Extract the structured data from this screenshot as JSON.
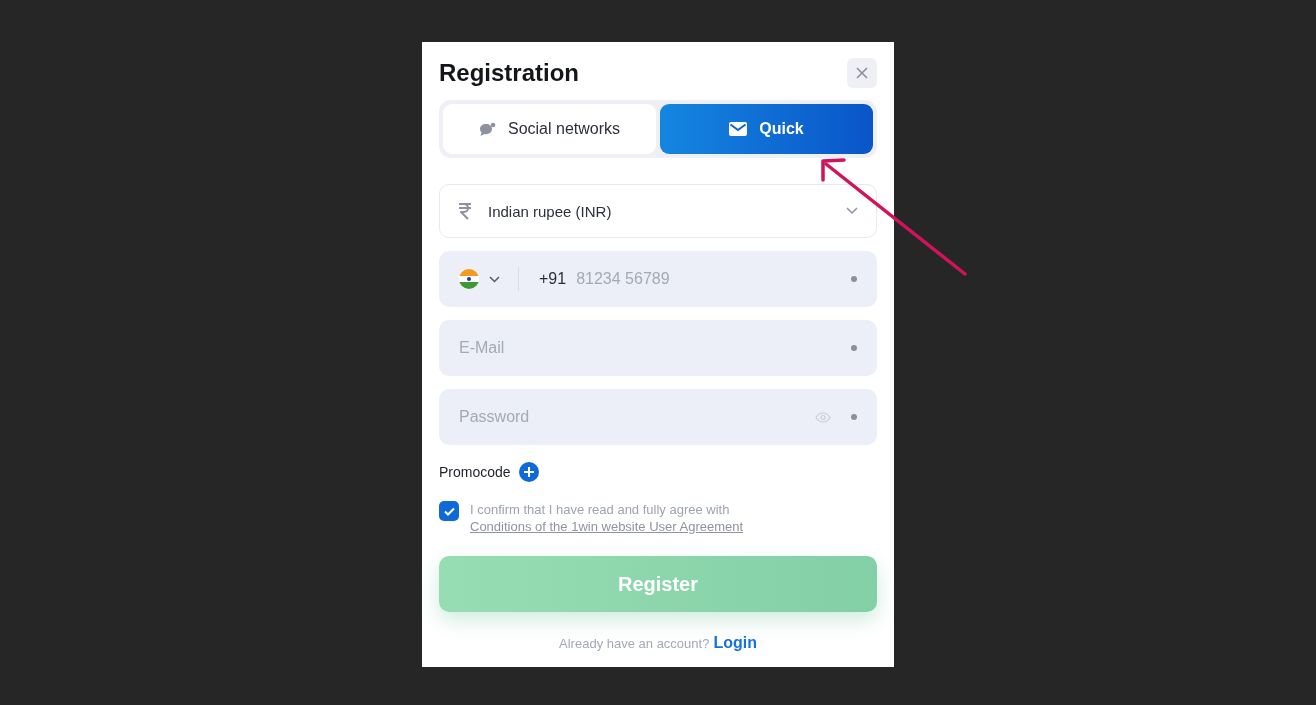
{
  "dialog": {
    "title": "Registration"
  },
  "tabs": [
    {
      "label": "Social networks",
      "kind": "social",
      "selected": false
    },
    {
      "label": "Quick",
      "kind": "mail",
      "selected": true
    }
  ],
  "currency": {
    "value": "Indian rupee (INR)"
  },
  "phone": {
    "code": "+91",
    "placeholder": "81234 56789",
    "required": true
  },
  "email": {
    "placeholder": "E-Mail",
    "required": true
  },
  "password": {
    "placeholder": "Password",
    "required": true
  },
  "promocode": {
    "label": "Promocode"
  },
  "agreement": {
    "checked": true,
    "text": "I confirm that I have read and fully agree with",
    "link": "Conditions of the 1win website User Agreement"
  },
  "register": {
    "label": "Register",
    "disabled": true
  },
  "footer": {
    "text": "Already have an account?",
    "link": "Login"
  }
}
